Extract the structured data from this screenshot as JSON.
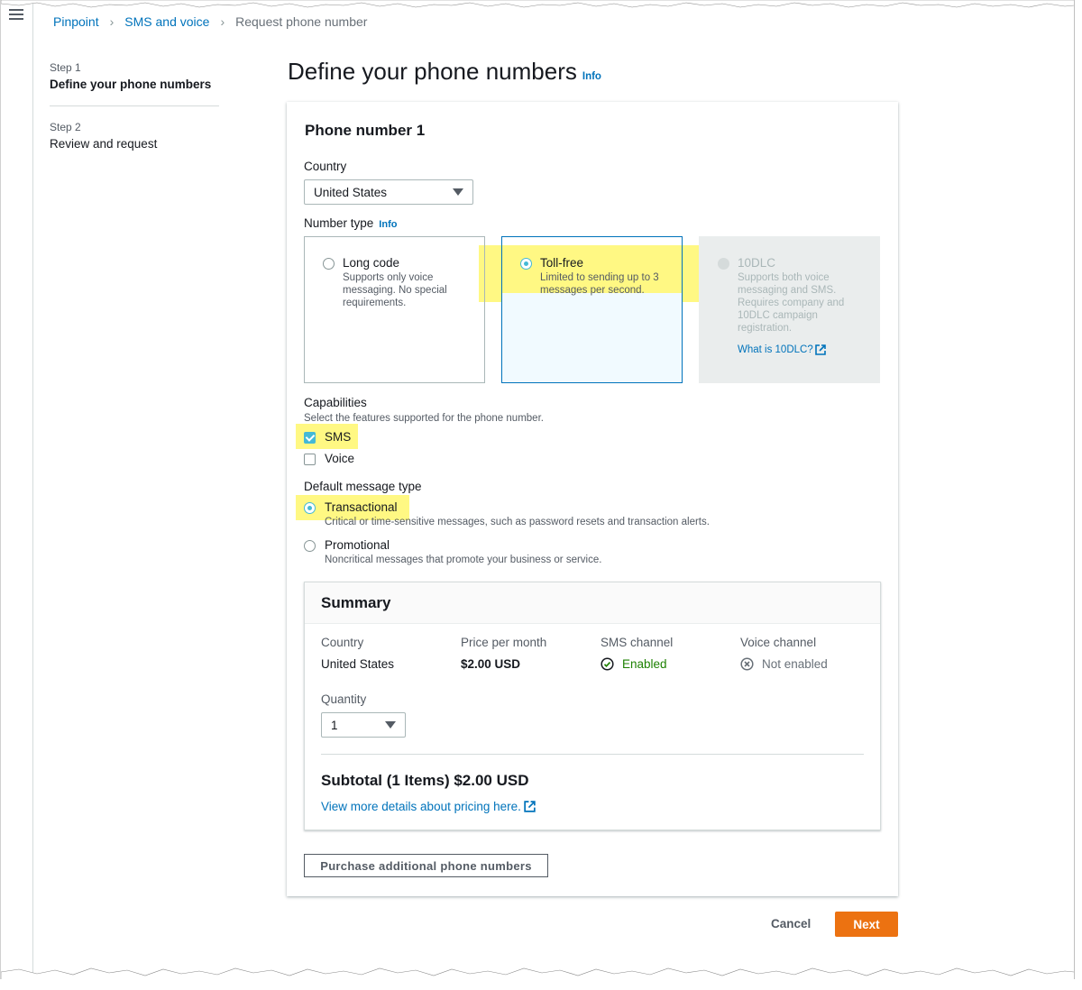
{
  "breadcrumb": {
    "items": [
      "Pinpoint",
      "SMS and voice"
    ],
    "current": "Request phone number"
  },
  "steps": [
    {
      "number": "Step 1",
      "title": "Define your phone numbers"
    },
    {
      "number": "Step 2",
      "title": "Review and request"
    }
  ],
  "page": {
    "title": "Define your phone numbers",
    "info": "Info"
  },
  "phone_number": {
    "title": "Phone number 1",
    "country_label": "Country",
    "country_value": "United States",
    "number_type_label": "Number type",
    "number_type_info": "Info",
    "number_types": [
      {
        "title": "Long code",
        "description": "Supports only voice messaging. No special requirements.",
        "selected": false,
        "disabled": false
      },
      {
        "title": "Toll-free",
        "description": "Limited to sending up to 3 messages per second.",
        "selected": true,
        "disabled": false
      },
      {
        "title": "10DLC",
        "description": "Supports both voice messaging and SMS. Requires company and 10DLC campaign registration.",
        "link": "What is 10DLC?",
        "selected": false,
        "disabled": true
      }
    ],
    "capabilities_label": "Capabilities",
    "capabilities_desc": "Select the features supported for the phone number.",
    "capabilities": [
      {
        "label": "SMS",
        "checked": true
      },
      {
        "label": "Voice",
        "checked": false
      }
    ],
    "message_type_label": "Default message type",
    "message_types": [
      {
        "label": "Transactional",
        "description": "Critical or time-sensitive messages, such as password resets and transaction alerts.",
        "selected": true
      },
      {
        "label": "Promotional",
        "description": "Noncritical messages that promote your business or service.",
        "selected": false
      }
    ]
  },
  "summary": {
    "title": "Summary",
    "country_label": "Country",
    "country_value": "United States",
    "price_label": "Price per month",
    "price_value": "$2.00 USD",
    "sms_label": "SMS channel",
    "sms_value": "Enabled",
    "voice_label": "Voice channel",
    "voice_value": "Not enabled",
    "quantity_label": "Quantity",
    "quantity_value": "1",
    "subtotal": "Subtotal (1 Items) $2.00 USD",
    "pricing_link": "View more details about pricing here."
  },
  "buttons": {
    "purchase_additional": "Purchase additional phone numbers",
    "cancel": "Cancel",
    "next": "Next"
  },
  "colors": {
    "link": "#0073bb",
    "primary_button": "#ec7211",
    "highlight": "#fff55a",
    "selected_tile": "#f1faff",
    "success": "#1d8102"
  }
}
